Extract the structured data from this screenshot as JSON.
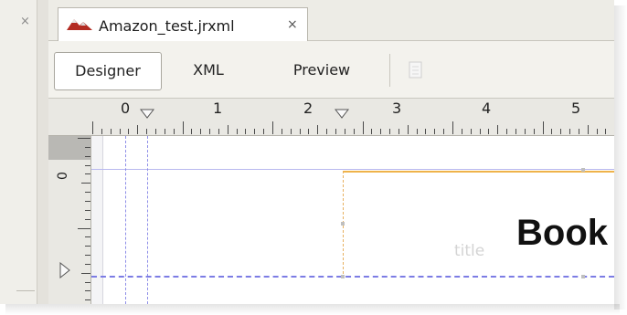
{
  "editor": {
    "file_tab": {
      "label": "Amazon_test.jrxml",
      "close_glyph": "×",
      "icon": "report-icon"
    },
    "left_panel_close_glyph": "×",
    "views": [
      {
        "label": "Designer",
        "active": true
      },
      {
        "label": "XML",
        "active": false
      },
      {
        "label": "Preview",
        "active": false
      }
    ],
    "toolbar_icon": "document-icon"
  },
  "ruler": {
    "horizontal_labels": [
      "0",
      "1",
      "2",
      "3",
      "4",
      "5"
    ],
    "vertical_label": "0",
    "marker_icon": "margin-marker-icon"
  },
  "canvas": {
    "title_field_text": "Book",
    "title_field_hint": "title"
  },
  "colors": {
    "field_border": "#efb34a",
    "guide_line": "#8e8ee8",
    "icon_red": "#c0392b"
  }
}
